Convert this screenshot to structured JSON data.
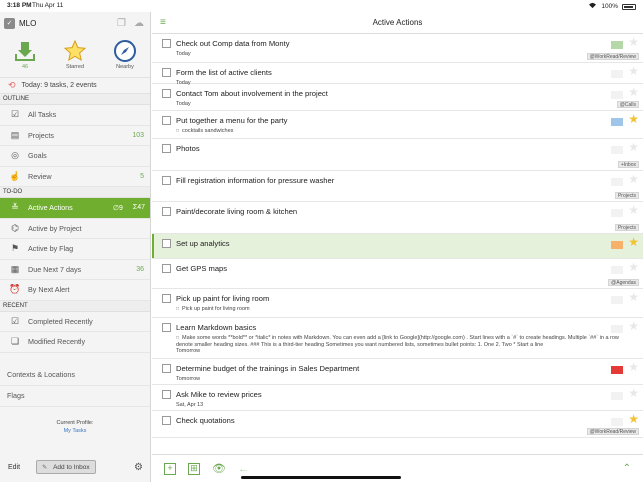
{
  "status": {
    "time": "3:18 PM",
    "date": "Thu Apr 11",
    "battery": "100%"
  },
  "sidebar": {
    "app_name": "MLO",
    "tiles": [
      {
        "label": "46",
        "icon": "inbox-tray-icon"
      },
      {
        "label": "Starred",
        "icon": "star-icon"
      },
      {
        "label": "Nearby",
        "icon": "compass-icon"
      }
    ],
    "today": "Today: 9 tasks, 2 events",
    "outline_label": "OUTLINE",
    "outline": [
      {
        "label": "All Tasks",
        "count": ""
      },
      {
        "label": "Projects",
        "count": "103"
      },
      {
        "label": "Goals",
        "count": ""
      },
      {
        "label": "Review",
        "count": "5"
      }
    ],
    "todo_label": "TO-DO",
    "todo": [
      {
        "label": "Active Actions",
        "badge1": "∅9",
        "badge2": "Σ47"
      },
      {
        "label": "Active by Project",
        "count": ""
      },
      {
        "label": "Active by Flag",
        "count": ""
      },
      {
        "label": "Due Next 7 days",
        "count": "36"
      },
      {
        "label": "By Next Alert",
        "count": ""
      }
    ],
    "recent_label": "RECENT",
    "recent": [
      {
        "label": "Completed Recently"
      },
      {
        "label": "Modified Recently"
      }
    ],
    "bottom": [
      {
        "label": "Contexts & Locations"
      },
      {
        "label": "Flags"
      }
    ],
    "profile_label": "Current Profile:",
    "profile_name": "My Tasks",
    "edit_label": "Edit",
    "add_inbox_label": "Add to Inbox"
  },
  "main": {
    "title": "Active Actions",
    "rows": [
      {
        "title": "Check out Comp data from Monty",
        "sub": "Today",
        "tag": "@WorkRead/Review",
        "flag": "#b6d7a8",
        "star": "outline"
      },
      {
        "title": "Form the list of active clients",
        "sub": "Today",
        "flag": "",
        "star": "outline"
      },
      {
        "title": "Contact Tom about involvement in the project",
        "sub": "Today",
        "tag": "@Calls",
        "flag": "",
        "star": "outline"
      },
      {
        "title": "Put together a menu for the party",
        "note": "cocktails sandwiches",
        "flag": "#9fc5e8",
        "star": "on"
      },
      {
        "title": "Photos",
        "tag": "+Inbox",
        "flag": "",
        "star": "outline"
      },
      {
        "title": "Fill registration information for pressure washer",
        "tag": "Projects",
        "flag": "",
        "star": "outline"
      },
      {
        "title": "Paint/decorate living room & kitchen",
        "tag": "Projects",
        "flag": "",
        "star": "outline"
      },
      {
        "title": "Set up analytics",
        "flag": "#f6b26b",
        "star": "on",
        "selected": true
      },
      {
        "title": "Get GPS maps",
        "tag": "@Agendas",
        "flag": "",
        "star": "outline"
      },
      {
        "title": "Pick up paint for living room",
        "note": "Pick up paint for living room",
        "flag": "",
        "star": "outline"
      },
      {
        "title": "Learn Markdown basics",
        "note": "Make some words **bold** or *italic* in notes with Markdown. You can even add a [link to Google](http://google.com) . Start lines with a `#` to create headings. Multiple `##` in a row denote smaller heading sizes. ### This is a third-tier heading Sometimes you want numbered lists, sometimes bullet points: 1. One 2. Two * Start a line",
        "sub": "Tomorrow",
        "flag": "",
        "star": "outline"
      },
      {
        "title": "Determine budget of the trainings in Sales Department",
        "sub": "Tomorrow",
        "flag": "#e53935",
        "star": "outline"
      },
      {
        "title": "Ask Mike to review prices",
        "sub": "Sat, Apr 13",
        "flag": "",
        "star": "outline"
      },
      {
        "title": "Check quotations",
        "sub": "",
        "tag": "@WorkRead/Review",
        "flag": "",
        "star": "on"
      }
    ]
  },
  "colors": {
    "accent": "#6fae2e",
    "selected_bg": "#e6f1dc",
    "count": "#6aa84f"
  }
}
